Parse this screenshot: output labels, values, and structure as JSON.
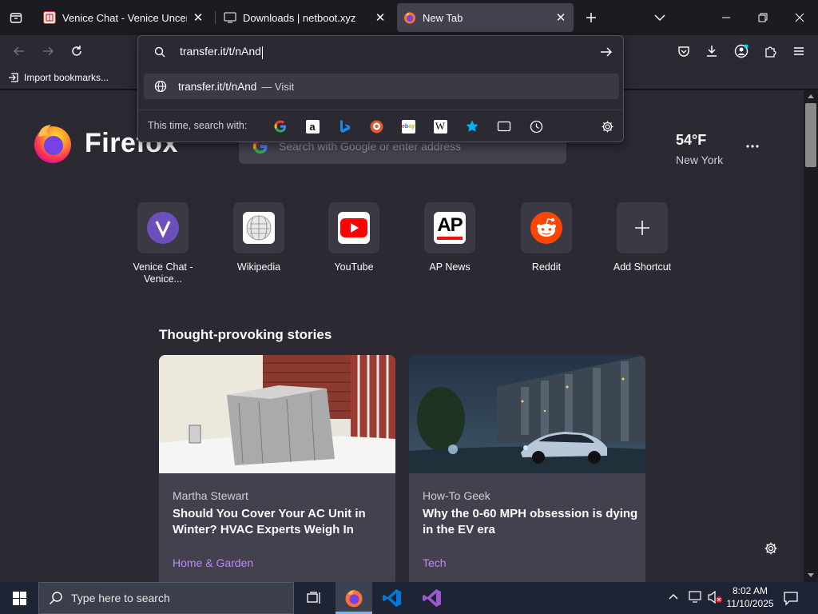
{
  "tabs": [
    {
      "title": "Venice Chat - Venice Uncensored",
      "close": "✕"
    },
    {
      "title": "Downloads | netboot.xyz",
      "close": "✕"
    },
    {
      "title": "New Tab",
      "close": "✕"
    }
  ],
  "bookmarks": {
    "import_label": "Import bookmarks..."
  },
  "url_panel": {
    "input_value": "transfer.it/t/nAnd",
    "suggestion_url": "transfer.it/t/nAnd",
    "suggestion_action": "— Visit",
    "search_with_label": "This time, search with:",
    "engines": [
      "google-icon",
      "amazon-icon",
      "bing-icon",
      "duckduckgo-icon",
      "ebay-icon",
      "wikipedia-icon",
      "bookmarks-icon",
      "tabs-icon",
      "history-icon"
    ]
  },
  "page": {
    "brand": "Firefox",
    "search_placeholder": "Search with Google or enter address",
    "weather": {
      "temp": "54°F",
      "location": "New York"
    },
    "shortcuts": [
      {
        "label": "Venice Chat - Venice...",
        "icon": "venice-icon"
      },
      {
        "label": "Wikipedia",
        "icon": "wikipedia-icon"
      },
      {
        "label": "YouTube",
        "icon": "youtube-icon"
      },
      {
        "label": "AP News",
        "icon": "ap-news-icon",
        "logo_text": "AP"
      },
      {
        "label": "Reddit",
        "icon": "reddit-icon"
      },
      {
        "label": "Add Shortcut",
        "icon": "plus-icon"
      }
    ],
    "stories_heading": "Thought-provoking stories",
    "stories": [
      {
        "source": "Martha Stewart",
        "headline": "Should You Cover Your AC Unit in Winter? HVAC Experts Weigh In",
        "category": "Home & Garden"
      },
      {
        "source": "How-To Geek",
        "headline": "Why the 0-60 MPH obsession is dying in the EV era",
        "category": "Tech"
      }
    ]
  },
  "taskbar": {
    "search_placeholder": "Type here to search",
    "time": "8:02 AM",
    "date": "11/10/2025"
  }
}
